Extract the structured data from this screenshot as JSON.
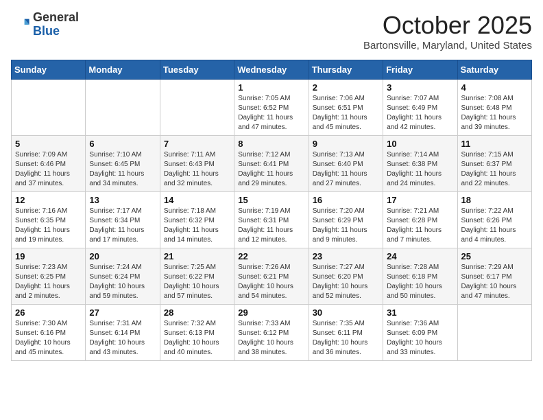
{
  "header": {
    "logo_general": "General",
    "logo_blue": "Blue",
    "month": "October 2025",
    "location": "Bartonsville, Maryland, United States"
  },
  "days_of_week": [
    "Sunday",
    "Monday",
    "Tuesday",
    "Wednesday",
    "Thursday",
    "Friday",
    "Saturday"
  ],
  "weeks": [
    [
      {
        "day": "",
        "details": ""
      },
      {
        "day": "",
        "details": ""
      },
      {
        "day": "",
        "details": ""
      },
      {
        "day": "1",
        "details": "Sunrise: 7:05 AM\nSunset: 6:52 PM\nDaylight: 11 hours\nand 47 minutes."
      },
      {
        "day": "2",
        "details": "Sunrise: 7:06 AM\nSunset: 6:51 PM\nDaylight: 11 hours\nand 45 minutes."
      },
      {
        "day": "3",
        "details": "Sunrise: 7:07 AM\nSunset: 6:49 PM\nDaylight: 11 hours\nand 42 minutes."
      },
      {
        "day": "4",
        "details": "Sunrise: 7:08 AM\nSunset: 6:48 PM\nDaylight: 11 hours\nand 39 minutes."
      }
    ],
    [
      {
        "day": "5",
        "details": "Sunrise: 7:09 AM\nSunset: 6:46 PM\nDaylight: 11 hours\nand 37 minutes."
      },
      {
        "day": "6",
        "details": "Sunrise: 7:10 AM\nSunset: 6:45 PM\nDaylight: 11 hours\nand 34 minutes."
      },
      {
        "day": "7",
        "details": "Sunrise: 7:11 AM\nSunset: 6:43 PM\nDaylight: 11 hours\nand 32 minutes."
      },
      {
        "day": "8",
        "details": "Sunrise: 7:12 AM\nSunset: 6:41 PM\nDaylight: 11 hours\nand 29 minutes."
      },
      {
        "day": "9",
        "details": "Sunrise: 7:13 AM\nSunset: 6:40 PM\nDaylight: 11 hours\nand 27 minutes."
      },
      {
        "day": "10",
        "details": "Sunrise: 7:14 AM\nSunset: 6:38 PM\nDaylight: 11 hours\nand 24 minutes."
      },
      {
        "day": "11",
        "details": "Sunrise: 7:15 AM\nSunset: 6:37 PM\nDaylight: 11 hours\nand 22 minutes."
      }
    ],
    [
      {
        "day": "12",
        "details": "Sunrise: 7:16 AM\nSunset: 6:35 PM\nDaylight: 11 hours\nand 19 minutes."
      },
      {
        "day": "13",
        "details": "Sunrise: 7:17 AM\nSunset: 6:34 PM\nDaylight: 11 hours\nand 17 minutes."
      },
      {
        "day": "14",
        "details": "Sunrise: 7:18 AM\nSunset: 6:32 PM\nDaylight: 11 hours\nand 14 minutes."
      },
      {
        "day": "15",
        "details": "Sunrise: 7:19 AM\nSunset: 6:31 PM\nDaylight: 11 hours\nand 12 minutes."
      },
      {
        "day": "16",
        "details": "Sunrise: 7:20 AM\nSunset: 6:29 PM\nDaylight: 11 hours\nand 9 minutes."
      },
      {
        "day": "17",
        "details": "Sunrise: 7:21 AM\nSunset: 6:28 PM\nDaylight: 11 hours\nand 7 minutes."
      },
      {
        "day": "18",
        "details": "Sunrise: 7:22 AM\nSunset: 6:26 PM\nDaylight: 11 hours\nand 4 minutes."
      }
    ],
    [
      {
        "day": "19",
        "details": "Sunrise: 7:23 AM\nSunset: 6:25 PM\nDaylight: 11 hours\nand 2 minutes."
      },
      {
        "day": "20",
        "details": "Sunrise: 7:24 AM\nSunset: 6:24 PM\nDaylight: 10 hours\nand 59 minutes."
      },
      {
        "day": "21",
        "details": "Sunrise: 7:25 AM\nSunset: 6:22 PM\nDaylight: 10 hours\nand 57 minutes."
      },
      {
        "day": "22",
        "details": "Sunrise: 7:26 AM\nSunset: 6:21 PM\nDaylight: 10 hours\nand 54 minutes."
      },
      {
        "day": "23",
        "details": "Sunrise: 7:27 AM\nSunset: 6:20 PM\nDaylight: 10 hours\nand 52 minutes."
      },
      {
        "day": "24",
        "details": "Sunrise: 7:28 AM\nSunset: 6:18 PM\nDaylight: 10 hours\nand 50 minutes."
      },
      {
        "day": "25",
        "details": "Sunrise: 7:29 AM\nSunset: 6:17 PM\nDaylight: 10 hours\nand 47 minutes."
      }
    ],
    [
      {
        "day": "26",
        "details": "Sunrise: 7:30 AM\nSunset: 6:16 PM\nDaylight: 10 hours\nand 45 minutes."
      },
      {
        "day": "27",
        "details": "Sunrise: 7:31 AM\nSunset: 6:14 PM\nDaylight: 10 hours\nand 43 minutes."
      },
      {
        "day": "28",
        "details": "Sunrise: 7:32 AM\nSunset: 6:13 PM\nDaylight: 10 hours\nand 40 minutes."
      },
      {
        "day": "29",
        "details": "Sunrise: 7:33 AM\nSunset: 6:12 PM\nDaylight: 10 hours\nand 38 minutes."
      },
      {
        "day": "30",
        "details": "Sunrise: 7:35 AM\nSunset: 6:11 PM\nDaylight: 10 hours\nand 36 minutes."
      },
      {
        "day": "31",
        "details": "Sunrise: 7:36 AM\nSunset: 6:09 PM\nDaylight: 10 hours\nand 33 minutes."
      },
      {
        "day": "",
        "details": ""
      }
    ]
  ]
}
